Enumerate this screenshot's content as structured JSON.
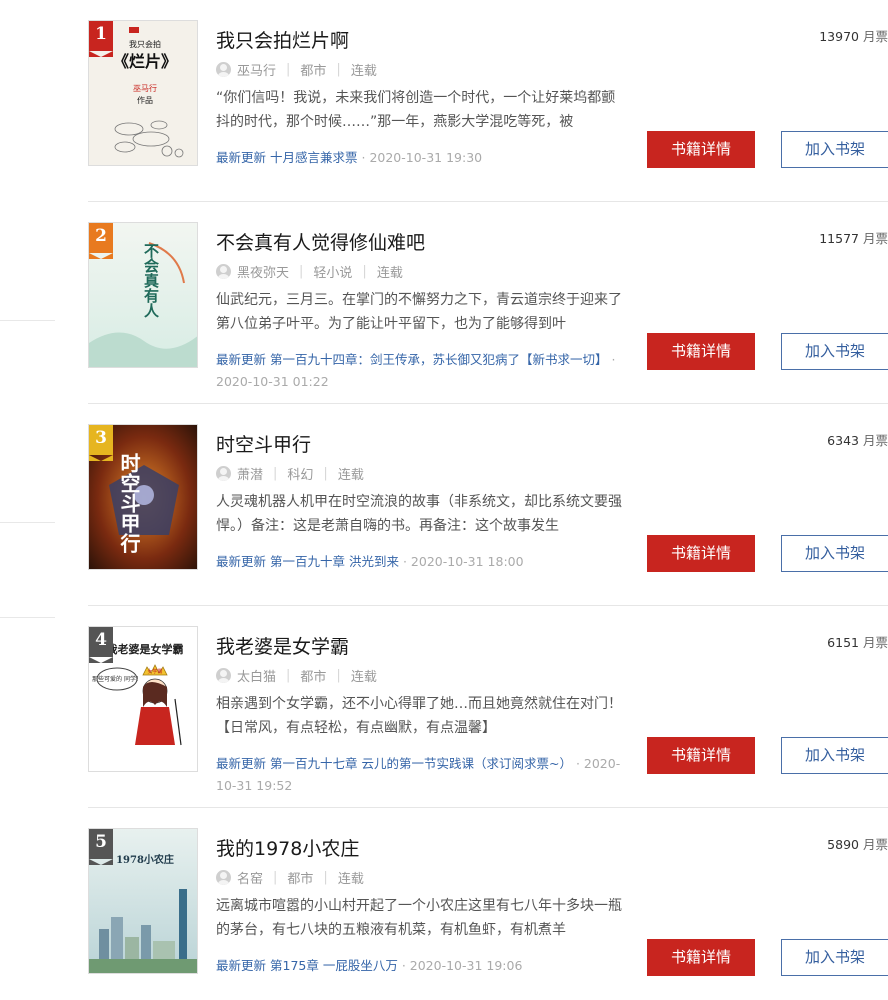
{
  "books": [
    {
      "rank": "1",
      "title": "我只会拍烂片啊",
      "author": "巫马行",
      "category": "都市",
      "status": "连载",
      "intro": "“你们信吗！我说，未来我们将创造一个时代，一个让好莱坞都颤抖的时代，那个时候……”那一年，燕影大学混吃等死，被",
      "update_label": "最新更新",
      "update_chapter": "十月感言兼求票",
      "update_time": "2020-10-31 19:30",
      "tickets": "13970",
      "ticket_unit": "月票",
      "detail_label": "书籍详情",
      "shelf_label": "加入书架",
      "cover": {
        "line1": "我只会拍",
        "line2": "《烂片》",
        "author": "巫马行",
        "suffix": "作品",
        "colors": [
          "#f3f0ea",
          "#c8251f"
        ]
      }
    },
    {
      "rank": "2",
      "title": "不会真有人觉得修仙难吧",
      "author": "黑夜弥天",
      "category": "轻小说",
      "status": "连载",
      "intro": "仙武纪元，三月三。在掌门的不懈努力之下，青云道宗终于迎来了第八位弟子叶平。为了能让叶平留下，也为了能够得到叶",
      "update_label": "最新更新",
      "update_chapter": "第一百九十四章：剑王传承，苏长御又犯病了【新书求一切】",
      "update_time": "2020-10-31 01:22",
      "tickets": "11577",
      "ticket_unit": "月票",
      "detail_label": "书籍详情",
      "shelf_label": "加入书架",
      "cover": {
        "title_text": "不会真有人",
        "colors": [
          "#e9f3ee",
          "#1f6a5a"
        ]
      }
    },
    {
      "rank": "3",
      "title": "时空斗甲行",
      "author": "萧潜",
      "category": "科幻",
      "status": "连载",
      "intro": "人灵魂机器人机甲在时空流浪的故事（非系统文，却比系统文要强悍。）备注：这是老萧自嗨的书。再备注：这个故事发生",
      "update_label": "最新更新",
      "update_chapter": "第一百九十章 洪光到来",
      "update_time": "2020-10-31 18:00",
      "tickets": "6343",
      "ticket_unit": "月票",
      "detail_label": "书籍详情",
      "shelf_label": "加入书架",
      "cover": {
        "title_text": "时空斗甲行",
        "colors": [
          "#2a1208",
          "#e2882a"
        ]
      }
    },
    {
      "rank": "4",
      "title": "我老婆是女学霸",
      "author": "太白猫",
      "category": "都市",
      "status": "连载",
      "intro": "相亲遇到个女学霸，还不小心得罪了她…而且她竟然就住在对门！【日常风，有点轻松，有点幽默，有点温馨】",
      "update_label": "最新更新",
      "update_chapter": "第一百九十七章 云儿的第一节实践课（求订阅求票~）",
      "update_time": "2020-10-31 19:52",
      "tickets": "6151",
      "ticket_unit": "月票",
      "detail_label": "书籍详情",
      "shelf_label": "加入书架",
      "cover": {
        "title_text": "我老婆是女学霸",
        "bubble": "那些可爱的 同学！",
        "crown": "女学霸",
        "colors": [
          "#ffffff",
          "#c8251f"
        ]
      }
    },
    {
      "rank": "5",
      "title": "我的1978小农庄",
      "author": "名窑",
      "category": "都市",
      "status": "连载",
      "intro": "远离城市喧嚣的小山村开起了一个小农庄这里有七八年十多块一瓶的茅台，有七八块的五粮液有机菜，有机鱼虾，有机煮羊",
      "update_label": "最新更新",
      "update_chapter": "第175章 一屁股坐八万",
      "update_time": "2020-10-31 19:06",
      "tickets": "5890",
      "ticket_unit": "月票",
      "detail_label": "书籍详情",
      "shelf_label": "加入书架",
      "cover": {
        "title_text": "1978小农庄",
        "colors": [
          "#cfe3e6",
          "#3a6e8a"
        ]
      }
    }
  ]
}
